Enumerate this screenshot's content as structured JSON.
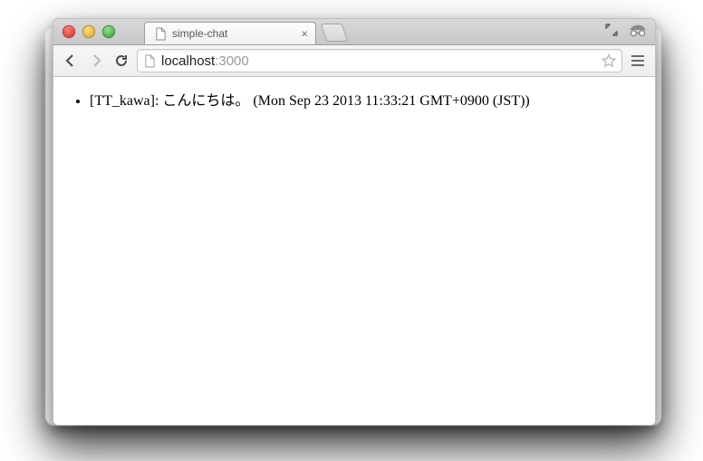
{
  "browser": {
    "tab": {
      "title": "simple-chat"
    },
    "address": {
      "host": "localhost",
      "port": ":3000"
    }
  },
  "content": {
    "messages": [
      {
        "user": "TT_kawa",
        "text": "こんにちは。",
        "time": "Mon Sep 23 2013 11:33:21 GMT+0900 (JST)"
      }
    ]
  }
}
